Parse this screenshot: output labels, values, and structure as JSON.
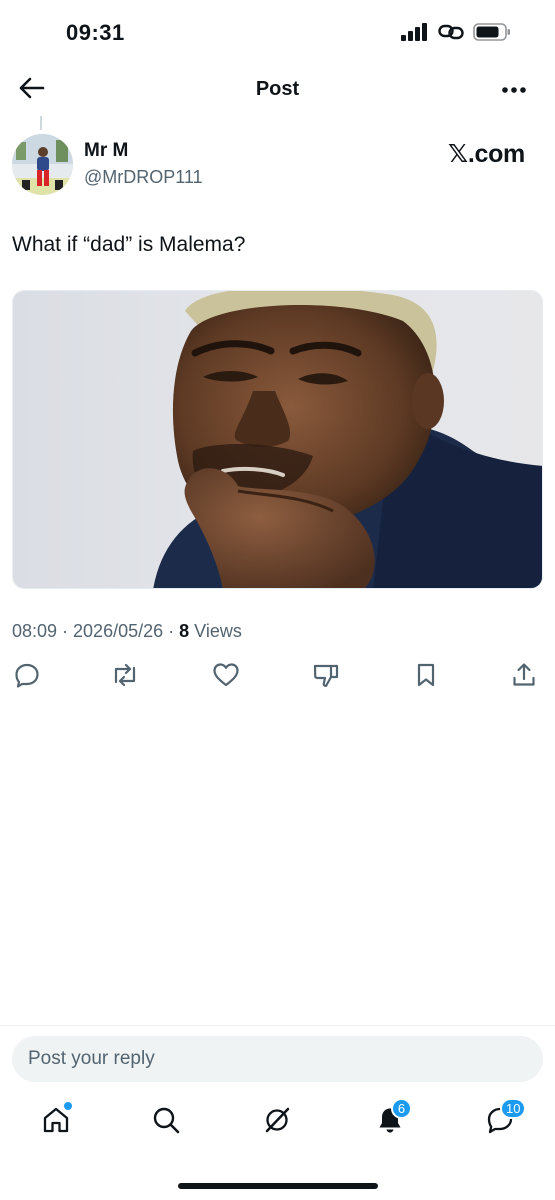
{
  "status_bar": {
    "time": "09:31"
  },
  "nav": {
    "title": "Post",
    "back_icon": "arrow-left-icon",
    "more_icon": "more-horizontal-icon"
  },
  "post": {
    "author_name": "Mr M",
    "author_handle": "@MrDROP111",
    "brand": "𝕏.com",
    "text": "What if “dad” is Malema?",
    "timestamp": "08:09 · 2026/05/26 · ",
    "views_count": "8",
    "views_label": " Views"
  },
  "actions": [
    "reply-icon",
    "repost-icon",
    "like-icon",
    "dislike-icon",
    "bookmark-icon",
    "share-icon"
  ],
  "reply": {
    "placeholder": "Post your reply"
  },
  "tabbar": {
    "notifications_badge": "6",
    "messages_badge": "10"
  },
  "colors": {
    "accent": "#1d9bf0",
    "text": "#0f1419",
    "muted": "#536471"
  }
}
